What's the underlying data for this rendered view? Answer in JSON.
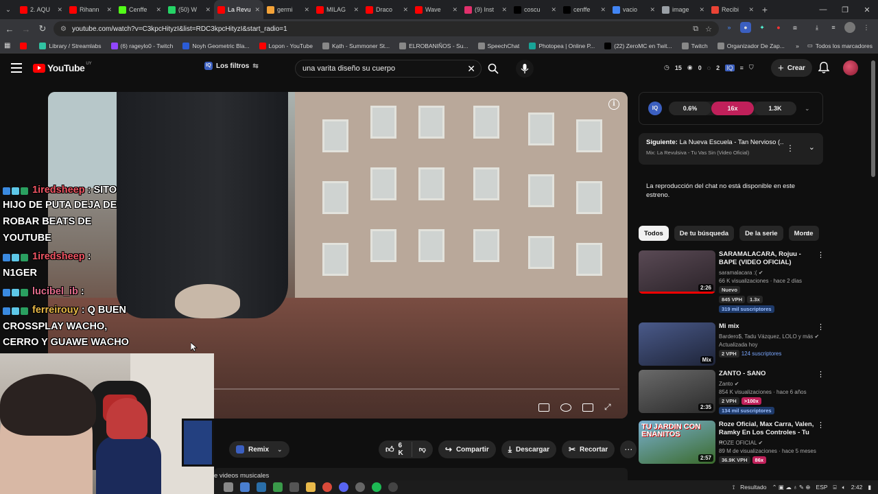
{
  "browser": {
    "tabs": [
      {
        "title": "2. AQU",
        "color": "#ff0000"
      },
      {
        "title": "Rihann",
        "color": "#ff0000"
      },
      {
        "title": "Cenffe",
        "color": "#53fc18"
      },
      {
        "title": "(50) W",
        "color": "#25d366"
      },
      {
        "title": "La Revu",
        "color": "#ff0000",
        "active": true
      },
      {
        "title": "germi",
        "color": "#f4a338"
      },
      {
        "title": "MILAG",
        "color": "#ff0000"
      },
      {
        "title": "Draco",
        "color": "#ff0000"
      },
      {
        "title": "Wave",
        "color": "#ff0000"
      },
      {
        "title": "(9) Inst",
        "color": "#e1306c"
      },
      {
        "title": "coscu",
        "color": "#000000"
      },
      {
        "title": "cenffe",
        "color": "#000000"
      },
      {
        "title": "vacio",
        "color": "#4285f4"
      },
      {
        "title": "image",
        "color": "#9aa0a6"
      },
      {
        "title": "Recibi",
        "color": "#ea4335"
      }
    ],
    "new_tab": "+",
    "url": "youtube.com/watch?v=C3kpcHityzI&list=RDC3kpcHityzI&start_radio=1",
    "bookmarks": [
      {
        "label": "",
        "color": "#ff0000"
      },
      {
        "label": "Library / Streamlabs",
        "color": "#31c3a2"
      },
      {
        "label": "(6) rageylo0 - Twitch",
        "color": "#9146ff"
      },
      {
        "label": "Noyh Geometric Bla...",
        "color": "#2b5cd6"
      },
      {
        "label": "Lopon - YouTube",
        "color": "#ff0000"
      },
      {
        "label": "Kạth - Summoner St...",
        "color": "#888888"
      },
      {
        "label": "ELROBANIÑOS - Su...",
        "color": "#888888"
      },
      {
        "label": "SpeechChat",
        "color": "#888888"
      },
      {
        "label": "Photopea | Online P...",
        "color": "#18a497"
      },
      {
        "label": "(22) ZeroMC en Twit...",
        "color": "#000000"
      },
      {
        "label": "Twitch",
        "color": "#888888"
      },
      {
        "label": "Organizador De Zap...",
        "color": "#888888"
      }
    ],
    "bookmarks_all": "Todos los marcadores"
  },
  "yt": {
    "logo": "YouTube",
    "logo_country": "UY",
    "filters_label": "Los filtros",
    "search_value": "una varita diseño su cuerpo",
    "stats": [
      "15",
      "0",
      "2"
    ],
    "create_label": "Crear"
  },
  "overlay_chat": [
    {
      "user": "1iredsheep",
      "text": ": SITO",
      "user_color": "red"
    },
    {
      "user": "",
      "text": "HIJO DE PUTA DEJA DE"
    },
    {
      "user": "",
      "text": "ROBAR BEATS DE"
    },
    {
      "user": "",
      "text": "YOUTUBE"
    },
    {
      "user": "1iredsheep",
      "text": ":",
      "user_color": "red"
    },
    {
      "user": "",
      "text": "N1GER"
    },
    {
      "user": "lucibel_ib",
      "text": ":",
      "user_color": "pink"
    },
    {
      "user": "ferreirouy",
      "text": ": Q BUEN",
      "user_color": "gold"
    },
    {
      "user": "",
      "text": "CROSSPLAY WACHO,"
    },
    {
      "user": "",
      "text": "CERRO Y GUAWE WACHO"
    }
  ],
  "below_video": {
    "remix_label": "Remix",
    "like_count": "6 K",
    "share_label": "Compartir",
    "download_label": "Descargar",
    "clip_label": "Recortar",
    "description_snippet": "e videos musicales"
  },
  "ext_panel": {
    "logo": "IQ",
    "values": [
      "0.6%",
      "16x",
      "1.3K"
    ]
  },
  "next_up": {
    "prefix": "Siguiente:",
    "title": "La Nueva Escuela - Tan Nervioso (...",
    "subtitle": "Mix: La Revulsiva - Tu Vas Sin (Video Oficial)"
  },
  "chat_unavailable": "La reproducción del chat no está disponible en este estreno.",
  "chips": [
    "Todos",
    "De tu búsqueda",
    "De la serie",
    "Monte"
  ],
  "recommendations": [
    {
      "title": "SARAMALACARA, Rojuu - BAPE (VIDEO OFICIAL)",
      "channel": "saramalacara :(",
      "meta": "66 K visualizaciones · hace 2 días",
      "badge": "Nuevo",
      "vph": "845 VPH",
      "mult": "1.3x",
      "subs": "319 mil suscriptores",
      "duration": "2:26",
      "progress": 1.0,
      "thumb": [
        "#5a4a55",
        "#2a2228"
      ]
    },
    {
      "title": "Mi mix",
      "channel": "Bardero$, Tadu Vázquez, LOLO y más",
      "meta": "Actualizada hoy",
      "vph": "2 VPH",
      "subs": "124 suscriptores",
      "duration": "Mix",
      "progress": 0,
      "thumb": [
        "#4a5a8a",
        "#1e2438"
      ]
    },
    {
      "title": "ZANTO - SANO",
      "channel": "Zanto",
      "meta": "854 K visualizaciones · hace 6 años",
      "vph": "2 VPH",
      "mult": ">100x",
      "subs": "134 mil suscriptores",
      "duration": "2:35",
      "progress": 0,
      "thumb": [
        "#6a6a6a",
        "#2a2a2a"
      ]
    },
    {
      "title": "Roze Oficial, Max Carra, Valen, Ramky En Los Controles - Tu ...",
      "channel": "ROZE OFICIAL",
      "meta": "89 M de visualizaciones · hace 5 meses",
      "vph": "36.9K VPH",
      "mult": "86x",
      "duration": "2:57",
      "thumb_text": "TU JARDIN CON ENANITOS",
      "progress": 0,
      "thumb": [
        "#7ab0d0",
        "#3a6a2a"
      ]
    }
  ],
  "taskbar": {
    "tray_text": "Resultado",
    "lang": "ESP",
    "time": "2:42"
  }
}
